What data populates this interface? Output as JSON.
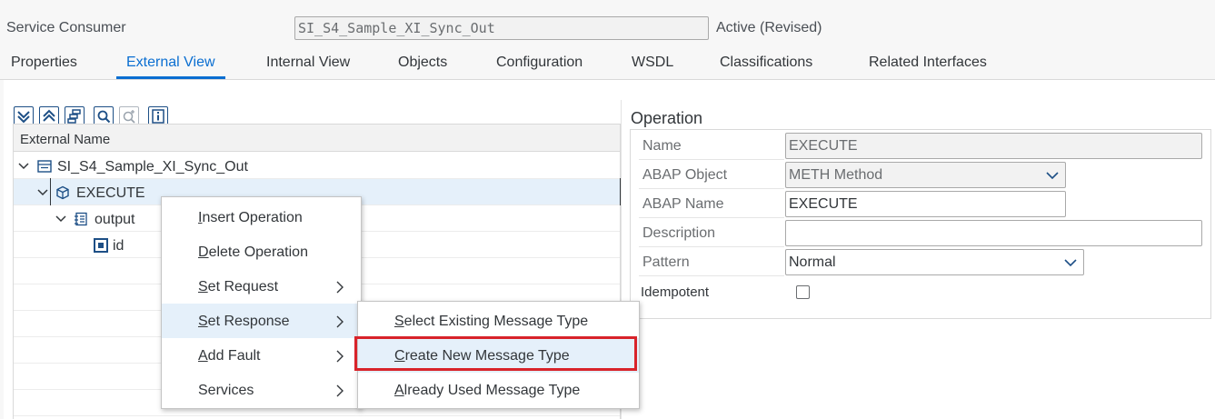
{
  "header": {
    "object_type": "Service Consumer",
    "object_name": "SI_S4_Sample_XI_Sync_Out",
    "status": "Active (Revised)"
  },
  "tabs": [
    {
      "label": "Properties",
      "active": false
    },
    {
      "label": "External View",
      "active": true
    },
    {
      "label": "Internal View",
      "active": false
    },
    {
      "label": "Objects",
      "active": false
    },
    {
      "label": "Configuration",
      "active": false
    },
    {
      "label": "WSDL",
      "active": false
    },
    {
      "label": "Classifications",
      "active": false
    },
    {
      "label": "Related Interfaces",
      "active": false
    }
  ],
  "toolbar": {
    "icons": [
      "expand-all-icon",
      "collapse-all-icon",
      "hierarchy-icon",
      "search-icon",
      "search-next-icon",
      "info-icon"
    ]
  },
  "tree": {
    "column_header": "External Name",
    "nodes": [
      {
        "label": "SI_S4_Sample_XI_Sync_Out",
        "icon": "interface-icon",
        "expanded": true
      },
      {
        "label": "EXECUTE",
        "icon": "operation-cube-icon",
        "expanded": true,
        "selected": true
      },
      {
        "label": "output",
        "icon": "message-icon",
        "expanded": true
      },
      {
        "label": "id",
        "icon": "field-icon"
      }
    ]
  },
  "operation": {
    "title": "Operation",
    "fields": {
      "name": {
        "label": "Name",
        "value": "EXECUTE"
      },
      "abap_object": {
        "label": "ABAP Object",
        "value": "METH Method"
      },
      "abap_name": {
        "label": "ABAP Name",
        "value": "EXECUTE"
      },
      "description": {
        "label": "Description",
        "value": ""
      },
      "pattern": {
        "label": "Pattern",
        "value": "Normal"
      },
      "idempotent": {
        "label": "Idempotent",
        "checked": false
      }
    }
  },
  "context_menu": {
    "items": [
      {
        "label": "Insert Operation",
        "submenu": false
      },
      {
        "label": "Delete Operation",
        "submenu": false
      },
      {
        "label": "Set Request",
        "submenu": true
      },
      {
        "label": "Set Response",
        "submenu": true,
        "hover": true
      },
      {
        "label": "Add Fault",
        "submenu": true
      },
      {
        "label": "Services",
        "submenu": true
      }
    ]
  },
  "submenu": {
    "items": [
      {
        "label": "Select Existing Message Type"
      },
      {
        "label": "Create New Message Type",
        "highlighted": true
      },
      {
        "label": "Already Used Message Type"
      }
    ]
  },
  "colors": {
    "accent": "#0a6ed1",
    "highlight_border": "#d8232a",
    "selection": "#e5f0fa"
  }
}
